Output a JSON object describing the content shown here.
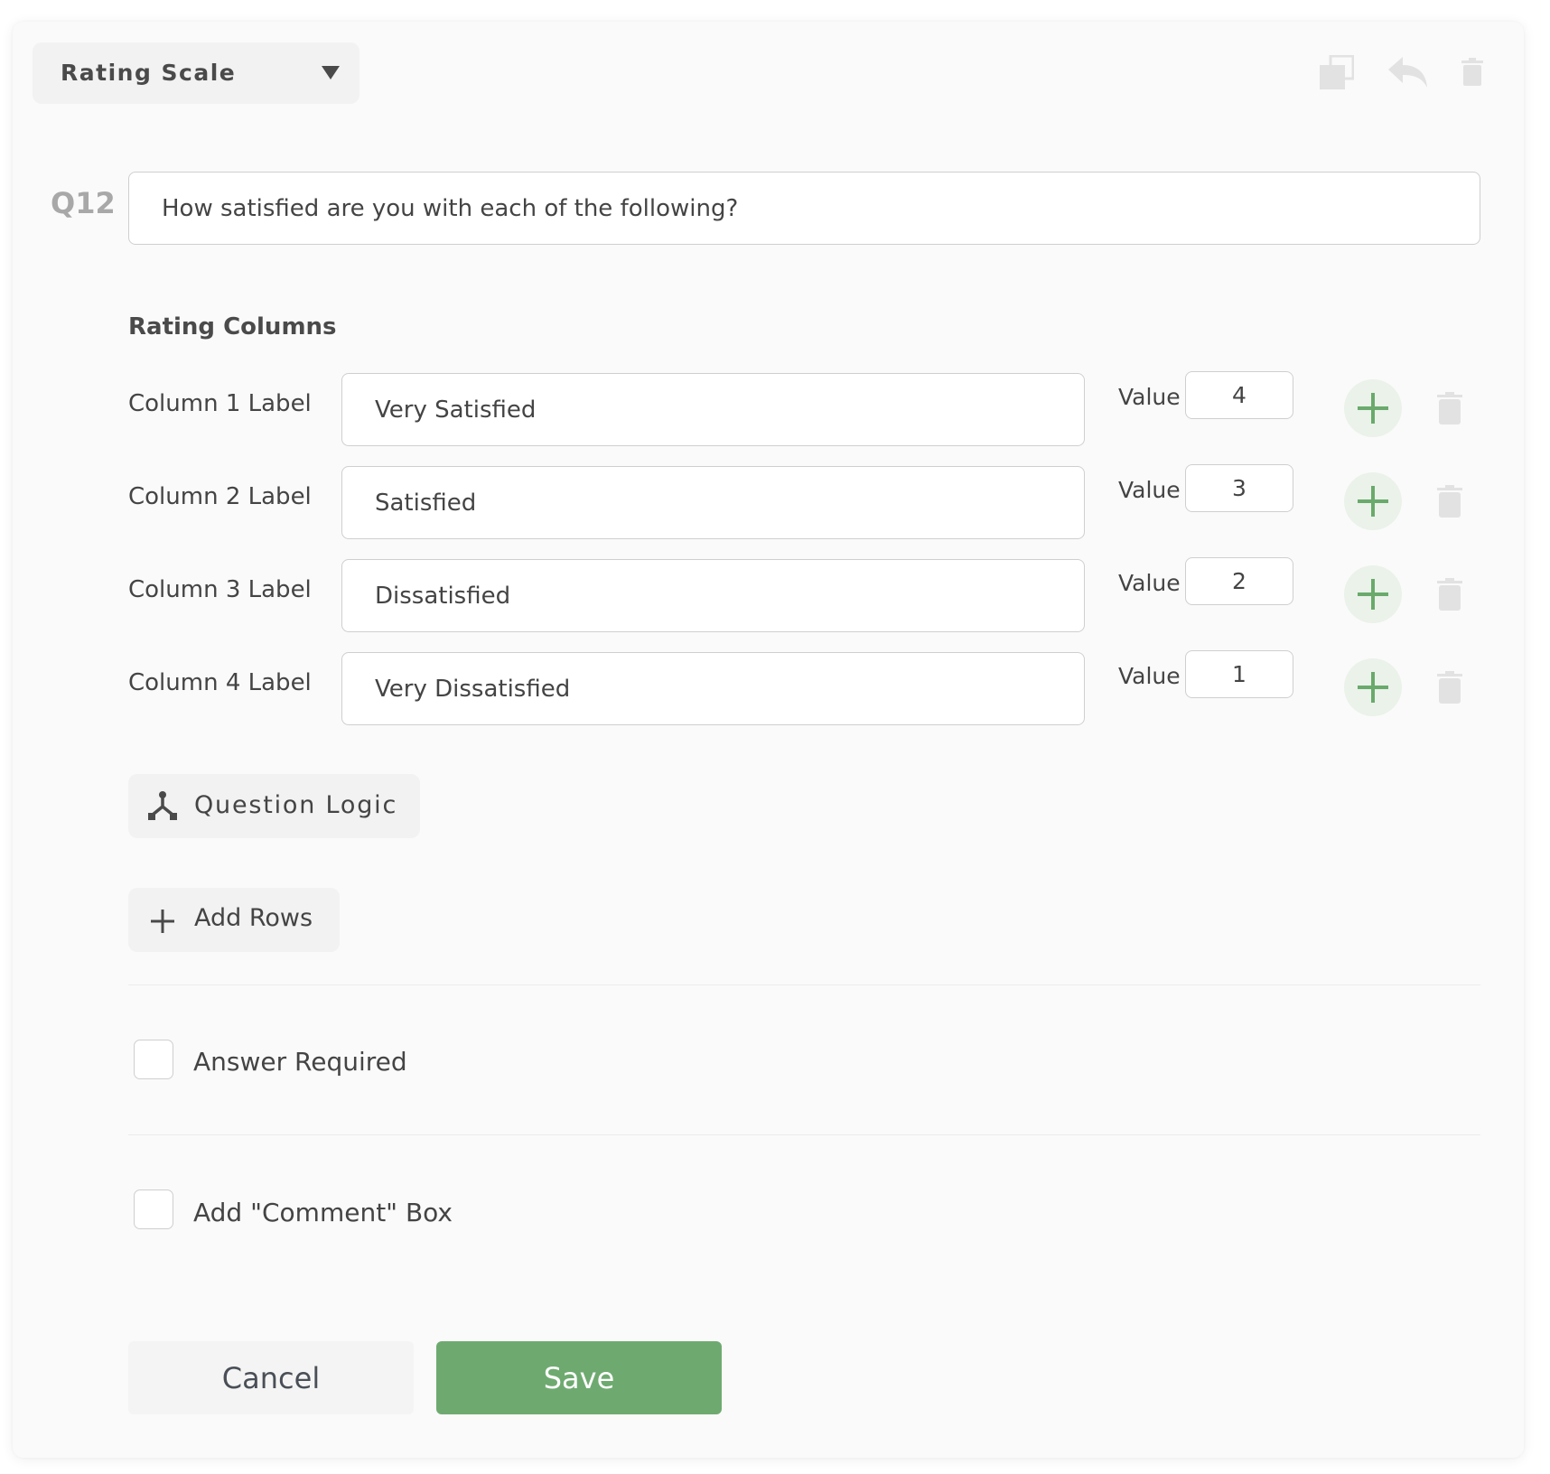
{
  "question_type": {
    "selected": "Rating Scale"
  },
  "toolbar": {
    "icons": [
      "copy-icon",
      "reply-icon",
      "trash-icon"
    ]
  },
  "question": {
    "number": "Q12",
    "text": "How satisfied are you with each of the following?"
  },
  "rating_columns": {
    "title": "Rating Columns",
    "value_label": "Value",
    "rows": [
      {
        "label": "Column 1 Label",
        "text": "Very Satisfied",
        "value": "4"
      },
      {
        "label": "Column 2 Label",
        "text": "Satisfied",
        "value": "3"
      },
      {
        "label": "Column 3 Label",
        "text": "Dissatisfied",
        "value": "2"
      },
      {
        "label": "Column 4 Label",
        "text": "Very Dissatisfied",
        "value": "1"
      }
    ]
  },
  "actions": {
    "question_logic": "Question Logic",
    "add_rows": "Add Rows"
  },
  "options": {
    "answer_required": {
      "label": "Answer Required",
      "checked": false
    },
    "comment_box": {
      "label": "Add \"Comment\" Box",
      "checked": false
    }
  },
  "footer": {
    "cancel": "Cancel",
    "save": "Save"
  },
  "colors": {
    "accent_green": "#6eaa70",
    "plus_bg": "#eaf2ea",
    "icon_gray": "#e2e2e2"
  }
}
